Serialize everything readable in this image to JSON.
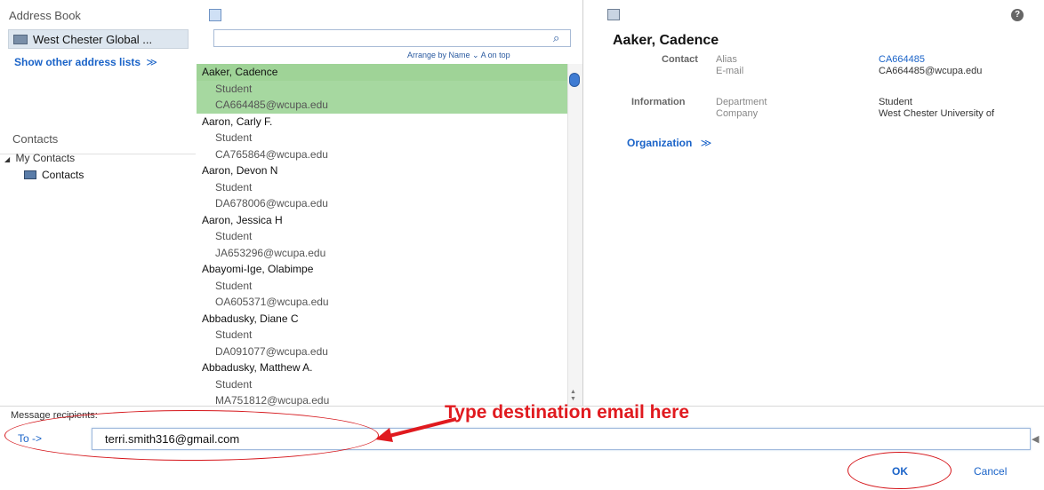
{
  "left_pane": {
    "address_book_title": "Address Book",
    "address_list_selected": "West Chester Global ...",
    "show_other_lists": "Show other address lists",
    "show_other_icon": "≫",
    "contacts_title": "Contacts",
    "my_contacts": "My Contacts",
    "contacts_item": "Contacts"
  },
  "middle_pane": {
    "search_placeholder": "",
    "search_icon": "⌕",
    "arrange_label": "Arrange by Name  ⌄   A on top",
    "entries": [
      {
        "name": "Aaker, Cadence",
        "role": "Student",
        "email": "CA664485@wcupa.edu",
        "selected": true
      },
      {
        "name": "Aaron, Carly F.",
        "role": "Student",
        "email": "CA765864@wcupa.edu",
        "selected": false
      },
      {
        "name": "Aaron, Devon N",
        "role": "Student",
        "email": "DA678006@wcupa.edu",
        "selected": false
      },
      {
        "name": "Aaron, Jessica H",
        "role": "Student",
        "email": "JA653296@wcupa.edu",
        "selected": false
      },
      {
        "name": "Abayomi-Ige, Olabimpe",
        "role": "Student",
        "email": "OA605371@wcupa.edu",
        "selected": false
      },
      {
        "name": "Abbadusky, Diane C",
        "role": "Student",
        "email": "DA091077@wcupa.edu",
        "selected": false
      },
      {
        "name": "Abbadusky, Matthew A.",
        "role": "Student",
        "email": "MA751812@wcupa.edu",
        "selected": false
      }
    ]
  },
  "detail_pane": {
    "name": "Aaker, Cadence",
    "contact_label": "Contact",
    "alias_label": "Alias",
    "email_label": "E-mail",
    "alias_value": "CA664485",
    "email_value": "CA664485@wcupa.edu",
    "information_label": "Information",
    "department_label": "Department",
    "company_label": "Company",
    "department_value": "Student",
    "company_value": "West Chester University of",
    "organization_link": "Organization",
    "organization_icon": "≫",
    "help_icon": "?"
  },
  "bottom": {
    "recipients_label": "Message recipients:",
    "to_button": "To ->",
    "to_value": "terri.smith316@gmail.com",
    "ok_button": "OK",
    "cancel_button": "Cancel"
  },
  "annotation": {
    "text": "Type destination email here",
    "color": "#e01a1f"
  },
  "colors": {
    "accent": "#1a63c8",
    "selection": "#a6d8a0"
  }
}
